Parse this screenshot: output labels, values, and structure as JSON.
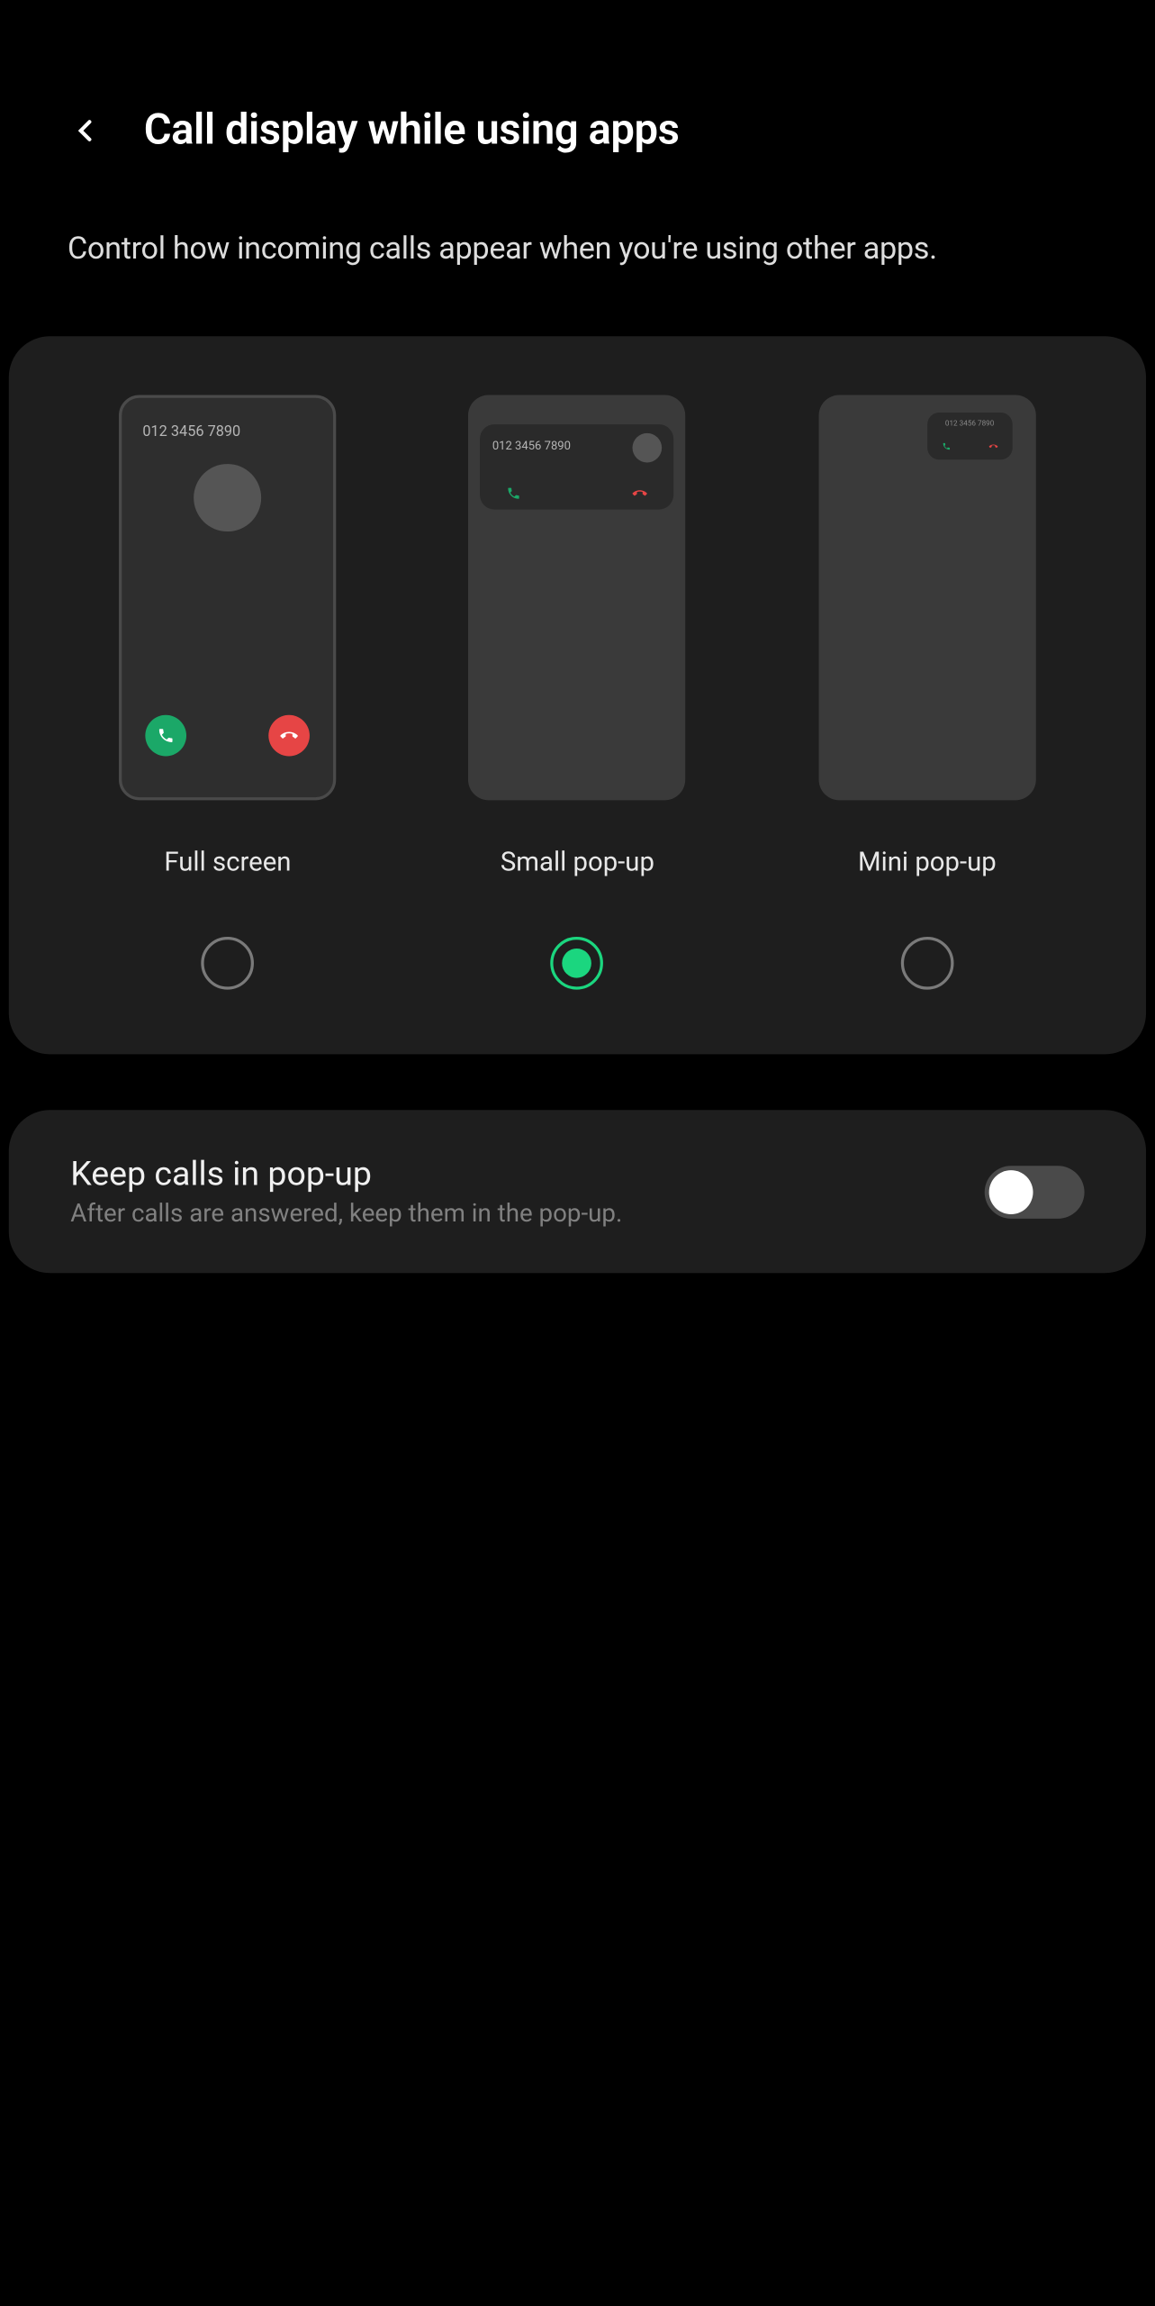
{
  "header": {
    "title": "Call display while using apps"
  },
  "description": "Control how incoming calls appear when you're using other apps.",
  "sample_number": "012 3456 7890",
  "options": {
    "full_screen": {
      "label": "Full screen",
      "selected": false
    },
    "small_popup": {
      "label": "Small pop-up",
      "selected": true
    },
    "mini_popup": {
      "label": "Mini pop-up",
      "selected": false
    }
  },
  "keep_in_popup": {
    "title": "Keep calls in pop-up",
    "subtitle": "After calls are answered, keep them in the pop-up.",
    "enabled": false
  }
}
